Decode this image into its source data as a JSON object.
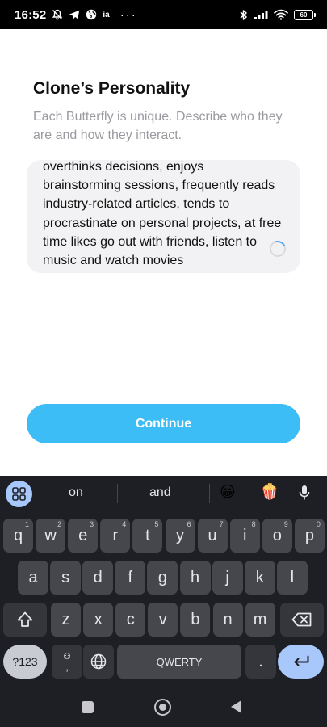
{
  "status_bar": {
    "time": "16:52",
    "carrier_text": "ia",
    "more": "···",
    "battery": "60",
    "icons": [
      "mute-icon",
      "telegram-icon",
      "vpn-icon",
      "bluetooth-icon",
      "signal-icon",
      "wifi-icon",
      "battery-icon"
    ]
  },
  "screen": {
    "title": "Clone’s Personality",
    "subtitle": "Each Butterfly is unique. Describe who they are and how they interact.",
    "textarea_value": "overthinks decisions, enjoys brainstorming sessions, frequently reads industry-related articles, tends to procrastinate on personal projects, at free time likes go out with friends, listen to music and watch movies",
    "loading": true,
    "continue_label": "Continue",
    "accent_color": "#3dbdf5"
  },
  "keyboard": {
    "suggestions": [
      "on",
      "and"
    ],
    "emoji_suggestions": [
      "😀",
      "🍿"
    ],
    "rows": [
      [
        {
          "key": "q",
          "hint": "1"
        },
        {
          "key": "w",
          "hint": "2"
        },
        {
          "key": "e",
          "hint": "3"
        },
        {
          "key": "r",
          "hint": "4"
        },
        {
          "key": "t",
          "hint": "5"
        },
        {
          "key": "y",
          "hint": "6"
        },
        {
          "key": "u",
          "hint": "7"
        },
        {
          "key": "i",
          "hint": "8"
        },
        {
          "key": "o",
          "hint": "9"
        },
        {
          "key": "p",
          "hint": "0"
        }
      ],
      [
        {
          "key": "a"
        },
        {
          "key": "s"
        },
        {
          "key": "d"
        },
        {
          "key": "f"
        },
        {
          "key": "g"
        },
        {
          "key": "h"
        },
        {
          "key": "j"
        },
        {
          "key": "k"
        },
        {
          "key": "l"
        }
      ],
      [
        {
          "key": "z"
        },
        {
          "key": "x"
        },
        {
          "key": "c"
        },
        {
          "key": "v"
        },
        {
          "key": "b"
        },
        {
          "key": "n"
        },
        {
          "key": "m"
        }
      ]
    ],
    "symbols_label": "?123",
    "emoji_key_top": "☺",
    "emoji_key_bottom": ",",
    "space_label": "QWERTY",
    "period_label": ".",
    "accent_color": "#a8c7fa"
  },
  "nav_bar": {
    "icons": [
      "recents-icon",
      "home-icon",
      "back-icon"
    ]
  }
}
